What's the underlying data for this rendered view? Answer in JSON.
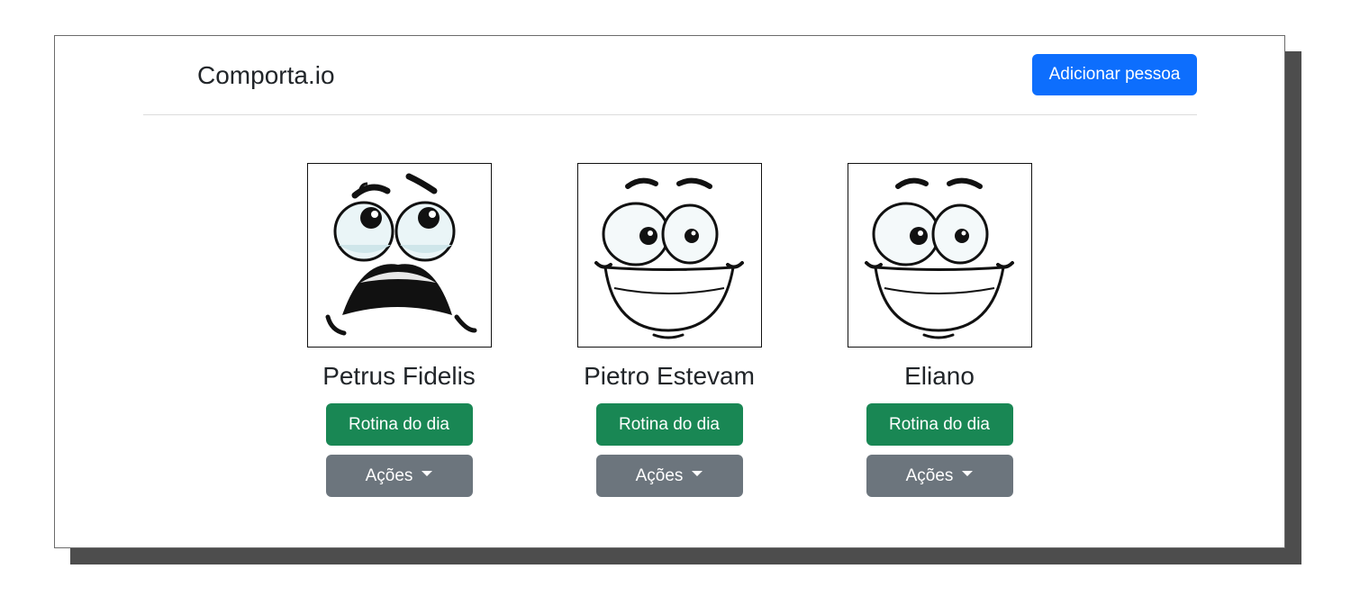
{
  "header": {
    "brand": "Comporta.io",
    "add_person_label": "Adicionar pessoa"
  },
  "people": [
    {
      "name": "Petrus Fidelis",
      "face": "scared-face-icon",
      "routine_label": "Rotina do dia",
      "actions_label": "Ações"
    },
    {
      "name": "Pietro Estevam",
      "face": "smiling-face-icon",
      "routine_label": "Rotina do dia",
      "actions_label": "Ações"
    },
    {
      "name": "Eliano",
      "face": "smiling-face-icon",
      "routine_label": "Rotina do dia",
      "actions_label": "Ações"
    }
  ],
  "colors": {
    "primary": "#0d6efd",
    "success": "#198754",
    "secondary": "#6c757d"
  }
}
